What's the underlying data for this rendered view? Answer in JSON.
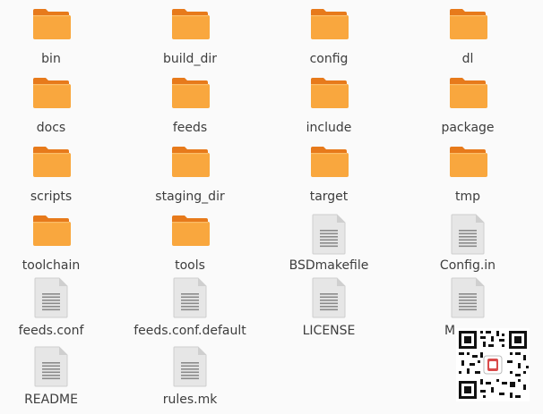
{
  "files": [
    {
      "name": "bin",
      "type": "folder"
    },
    {
      "name": "build_dir",
      "type": "folder"
    },
    {
      "name": "config",
      "type": "folder"
    },
    {
      "name": "dl",
      "type": "folder"
    },
    {
      "name": "docs",
      "type": "folder"
    },
    {
      "name": "feeds",
      "type": "folder"
    },
    {
      "name": "include",
      "type": "folder"
    },
    {
      "name": "package",
      "type": "folder"
    },
    {
      "name": "scripts",
      "type": "folder"
    },
    {
      "name": "staging_dir",
      "type": "folder"
    },
    {
      "name": "target",
      "type": "folder"
    },
    {
      "name": "tmp",
      "type": "folder"
    },
    {
      "name": "toolchain",
      "type": "folder"
    },
    {
      "name": "tools",
      "type": "folder"
    },
    {
      "name": "BSDmakefile",
      "type": "document"
    },
    {
      "name": "Config.in",
      "type": "document"
    },
    {
      "name": "feeds.conf",
      "type": "document"
    },
    {
      "name": "feeds.conf.default",
      "type": "document"
    },
    {
      "name": "LICENSE",
      "type": "document"
    },
    {
      "name": "M",
      "type": "document"
    },
    {
      "name": "README",
      "type": "document"
    },
    {
      "name": "rules.mk",
      "type": "document"
    }
  ],
  "colors": {
    "folder_body": "#f9a73e",
    "folder_tab": "#e77a1b",
    "document_paper": "#e8e8e8",
    "background": "#fafafa"
  },
  "icons": {
    "folder": "folder-icon",
    "document": "text-document-icon"
  }
}
